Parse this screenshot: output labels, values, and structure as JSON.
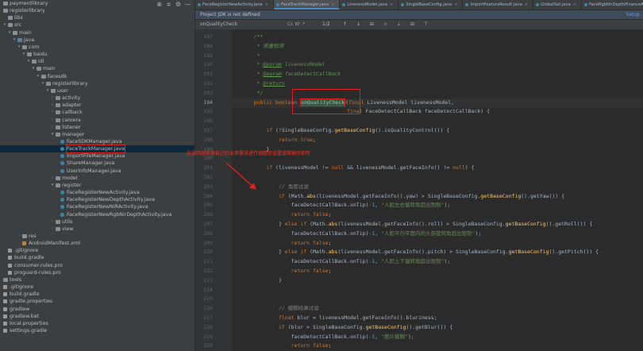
{
  "tree_header_icons": [
    "⊕",
    "≑",
    "⚙",
    "—"
  ],
  "tree": [
    {
      "label": "paymentlibrary",
      "indent": 0,
      "arrow": "",
      "icon": "folder"
    },
    {
      "label": "registerlibrary",
      "indent": 0,
      "arrow": "",
      "icon": "folder"
    },
    {
      "label": "libs",
      "indent": 1,
      "arrow": "",
      "icon": "folder"
    },
    {
      "label": "src",
      "indent": 1,
      "arrow": "▾",
      "icon": "folder"
    },
    {
      "label": "main",
      "indent": 2,
      "arrow": "▾",
      "icon": "folder"
    },
    {
      "label": "java",
      "indent": 3,
      "arrow": "▾",
      "icon": "srcf"
    },
    {
      "label": "com",
      "indent": 4,
      "arrow": "▾",
      "icon": "pkg"
    },
    {
      "label": "baidu",
      "indent": 5,
      "arrow": "▾",
      "icon": "pkg"
    },
    {
      "label": "idl",
      "indent": 6,
      "arrow": "▾",
      "icon": "pkg"
    },
    {
      "label": "main",
      "indent": 7,
      "arrow": "▾",
      "icon": "pkg"
    },
    {
      "label": "facesdk",
      "indent": 8,
      "arrow": "▾",
      "icon": "pkg"
    },
    {
      "label": "registerlibrary",
      "indent": 9,
      "arrow": "▾",
      "icon": "pkg"
    },
    {
      "label": "user",
      "indent": 10,
      "arrow": "▾",
      "icon": "pkg"
    },
    {
      "label": "activity",
      "indent": 11,
      "arrow": "›",
      "icon": "pkg"
    },
    {
      "label": "adapter",
      "indent": 11,
      "arrow": "›",
      "icon": "pkg"
    },
    {
      "label": "callback",
      "indent": 11,
      "arrow": "›",
      "icon": "pkg"
    },
    {
      "label": "camera",
      "indent": 11,
      "arrow": "›",
      "icon": "pkg"
    },
    {
      "label": "listener",
      "indent": 11,
      "arrow": "›",
      "icon": "pkg"
    },
    {
      "label": "manager",
      "indent": 11,
      "arrow": "▾",
      "icon": "pkg"
    },
    {
      "label": "FaceSDKManager.java",
      "indent": 12,
      "arrow": "",
      "icon": "java"
    },
    {
      "label": "FaceTrackManager.java",
      "indent": 12,
      "arrow": "",
      "icon": "java",
      "selected": true
    },
    {
      "label": "ImportFileManager.java",
      "indent": 12,
      "arrow": "",
      "icon": "java"
    },
    {
      "label": "ShareManager.java",
      "indent": 12,
      "arrow": "",
      "icon": "java"
    },
    {
      "label": "UserInfoManager.java",
      "indent": 12,
      "arrow": "",
      "icon": "java"
    },
    {
      "label": "model",
      "indent": 11,
      "arrow": "›",
      "icon": "pkg"
    },
    {
      "label": "register",
      "indent": 11,
      "arrow": "▾",
      "icon": "pkg"
    },
    {
      "label": "FaceRegisterNewActivity.java",
      "indent": 12,
      "arrow": "",
      "icon": "java"
    },
    {
      "label": "FaceRegisterNewDepthActivity.java",
      "indent": 12,
      "arrow": "",
      "icon": "java"
    },
    {
      "label": "FaceRegisterNewNIRActivity.java",
      "indent": 12,
      "arrow": "",
      "icon": "java"
    },
    {
      "label": "FaceRegisterNewRgbNirDepthActivity.java",
      "indent": 12,
      "arrow": "",
      "icon": "java"
    },
    {
      "label": "utils",
      "indent": 11,
      "arrow": "›",
      "icon": "pkg"
    },
    {
      "label": "view",
      "indent": 11,
      "arrow": "›",
      "icon": "pkg"
    },
    {
      "label": "res",
      "indent": 4,
      "arrow": "›",
      "icon": "folder"
    },
    {
      "label": "AndroidManifest.xml",
      "indent": 4,
      "arrow": "",
      "icon": "xml"
    },
    {
      "label": ".gitignore",
      "indent": 1,
      "arrow": "",
      "icon": "file"
    },
    {
      "label": "build.gradle",
      "indent": 1,
      "arrow": "",
      "icon": "file"
    },
    {
      "label": "consumer-rules.pro",
      "indent": 1,
      "arrow": "",
      "icon": "file"
    },
    {
      "label": "proguard-rules.pro",
      "indent": 1,
      "arrow": "",
      "icon": "file"
    },
    {
      "label": "tools",
      "indent": 0,
      "arrow": "",
      "icon": "folder"
    },
    {
      "label": ".gitignore",
      "indent": 0,
      "arrow": "",
      "icon": "file"
    },
    {
      "label": "build.gradle",
      "indent": 0,
      "arrow": "",
      "icon": "file"
    },
    {
      "label": "gradle.properties",
      "indent": 0,
      "arrow": "",
      "icon": "file"
    },
    {
      "label": "gradlew",
      "indent": 0,
      "arrow": "",
      "icon": "file"
    },
    {
      "label": "gradlew.bat",
      "indent": 0,
      "arrow": "",
      "icon": "file"
    },
    {
      "label": "local.properties",
      "indent": 0,
      "arrow": "",
      "icon": "file"
    },
    {
      "label": "settings.gradle",
      "indent": 0,
      "arrow": "",
      "icon": "file"
    }
  ],
  "tabs": [
    {
      "label": "FaceRegisterNewActivity.java"
    },
    {
      "label": "FaceTrackManager.java",
      "active": true
    },
    {
      "label": "LivenessModel.java"
    },
    {
      "label": "SingleBaseConfig.java"
    },
    {
      "label": "ImportFeatureResult.java"
    },
    {
      "label": "GlobalSet.java"
    },
    {
      "label": "FaceRgbNirDepthFinanceActivity.java"
    }
  ],
  "tab_close_glyph": "×",
  "notice": {
    "text": "Project JDK is not defined",
    "link": "Setup"
  },
  "search": {
    "query": "onQualityCheck",
    "options": "Cc W .*",
    "count": "1/2",
    "buttons": "↑ ↓ ⊟ ⊹ ⊥ ⊟ ⊤"
  },
  "line_numbers": [
    "187",
    "188",
    "189",
    "190",
    "191",
    "192",
    "193",
    "194",
    "195",
    "196",
    "197",
    "198",
    "199",
    "200",
    "201",
    "202",
    "203",
    "204",
    "205",
    "206",
    "207",
    "208",
    "209",
    "210",
    "211",
    "212",
    "213",
    "214",
    "215",
    "216",
    "217",
    "218",
    "219",
    "220"
  ],
  "current_line": "194",
  "code": [
    [
      [
        "c",
        "    /**"
      ]
    ],
    [
      [
        "c",
        "     * 质量检测"
      ]
    ],
    [
      [
        "c",
        "     *"
      ]
    ],
    [
      [
        "c",
        "     * "
      ],
      [
        "t",
        "@param"
      ],
      [
        "c",
        " livenessModel"
      ]
    ],
    [
      [
        "c",
        "     * "
      ],
      [
        "t",
        "@param"
      ],
      [
        "c",
        " faceDetectCallBack"
      ]
    ],
    [
      [
        "c",
        "     * "
      ],
      [
        "t",
        "@return"
      ]
    ],
    [
      [
        "c",
        "     */"
      ]
    ],
    [
      [
        "k",
        "    public boolean "
      ],
      [
        "m",
        "onQualityCheck"
      ],
      [
        "p",
        "("
      ],
      [
        "k",
        "final "
      ],
      [
        "p",
        "LivenessModel livenessModel,"
      ]
    ],
    [
      [
        "p",
        "                                  "
      ],
      [
        "k",
        "final "
      ],
      [
        "p",
        "FaceDetectCallBack faceDetectCallBack) {"
      ]
    ],
    [
      [
        "p",
        ""
      ]
    ],
    [
      [
        "k",
        "        if "
      ],
      [
        "p",
        "(!SingleBaseConfig."
      ],
      [
        "f",
        "getBaseConfig"
      ],
      [
        "p",
        "().isQualityControl()) {"
      ]
    ],
    [
      [
        "k",
        "            return true"
      ],
      [
        "p",
        ";"
      ]
    ],
    [
      [
        "p",
        "        }"
      ]
    ],
    [
      [
        "p",
        ""
      ]
    ],
    [
      [
        "k",
        "        if "
      ],
      [
        "p",
        "(livenessModel != "
      ],
      [
        "k",
        "null "
      ],
      [
        "p",
        "&& livenessModel.getFaceInfo() != "
      ],
      [
        "k",
        "null"
      ],
      [
        "p",
        ") {"
      ]
    ],
    [
      [
        "p",
        ""
      ]
    ],
    [
      [
        "cm",
        "            // 角度过滤"
      ]
    ],
    [
      [
        "k",
        "            if "
      ],
      [
        "p",
        "(Math."
      ],
      [
        "f",
        "abs"
      ],
      [
        "p",
        "(livenessModel.getFaceInfo().yaw) > SingleBaseConfig."
      ],
      [
        "f",
        "getBaseConfig"
      ],
      [
        "p",
        "().getYaw()) {"
      ]
    ],
    [
      [
        "p",
        "                faceDetectCallBack.onTip("
      ],
      [
        "n",
        "-1"
      ],
      [
        "p",
        ", "
      ],
      [
        "s",
        "\"人脸左右偏转角超出限制\""
      ],
      [
        "p",
        ");"
      ]
    ],
    [
      [
        "k",
        "                return false"
      ],
      [
        "p",
        ";"
      ]
    ],
    [
      [
        "p",
        "            } "
      ],
      [
        "k",
        "else if "
      ],
      [
        "p",
        "(Math."
      ],
      [
        "f",
        "abs"
      ],
      [
        "p",
        "(livenessModel.getFaceInfo().roll) > SingleBaseConfig."
      ],
      [
        "f",
        "getBaseConfig"
      ],
      [
        "p",
        "().getRoll()) {"
      ]
    ],
    [
      [
        "p",
        "                faceDetectCallBack.onTip("
      ],
      [
        "n",
        "-1"
      ],
      [
        "p",
        ", "
      ],
      [
        "s",
        "\"人脸平行平面内的头部旋转角超出限制\""
      ],
      [
        "p",
        ");"
      ]
    ],
    [
      [
        "k",
        "                return false"
      ],
      [
        "p",
        ";"
      ]
    ],
    [
      [
        "p",
        "            } "
      ],
      [
        "k",
        "else if "
      ],
      [
        "p",
        "(Math."
      ],
      [
        "f",
        "abs"
      ],
      [
        "p",
        "(livenessModel.getFaceInfo().pitch) > SingleBaseConfig."
      ],
      [
        "f",
        "getBaseConfig"
      ],
      [
        "p",
        "().getPitch()) {"
      ]
    ],
    [
      [
        "p",
        "                faceDetectCallBack.onTip("
      ],
      [
        "n",
        "-1"
      ],
      [
        "p",
        ", "
      ],
      [
        "s",
        "\"人脸上下偏转角超出限制\""
      ],
      [
        "p",
        ");"
      ]
    ],
    [
      [
        "k",
        "                return false"
      ],
      [
        "p",
        ";"
      ]
    ],
    [
      [
        "p",
        "            }"
      ]
    ],
    [
      [
        "p",
        ""
      ]
    ],
    [
      [
        "p",
        ""
      ]
    ],
    [
      [
        "cm",
        "            // 模糊结果过滤"
      ]
    ],
    [
      [
        "k",
        "            float "
      ],
      [
        "p",
        "blur = livenessModel.getFaceInfo().bluriness;"
      ]
    ],
    [
      [
        "k",
        "            if "
      ],
      [
        "p",
        "(blur > SingleBaseConfig."
      ],
      [
        "f",
        "getBaseConfig"
      ],
      [
        "p",
        "().getBlur()) {"
      ]
    ],
    [
      [
        "p",
        "                faceDetectCallBack.onTip("
      ],
      [
        "n",
        "-1"
      ],
      [
        "p",
        ", "
      ],
      [
        "s",
        "\"图片模糊\""
      ],
      [
        "p",
        ");"
      ]
    ],
    [
      [
        "k",
        "                return false"
      ],
      [
        "p",
        ";"
      ]
    ]
  ],
  "annotation": "在该回调根据自己的业务需求进行调整和设置逻辑操作即可",
  "colors": {
    "annotation": "#e83a2a",
    "keyword": "#cc7832",
    "comment": "#629755",
    "string": "#6a8759",
    "number": "#6897bb",
    "method": "#ffc66d"
  }
}
